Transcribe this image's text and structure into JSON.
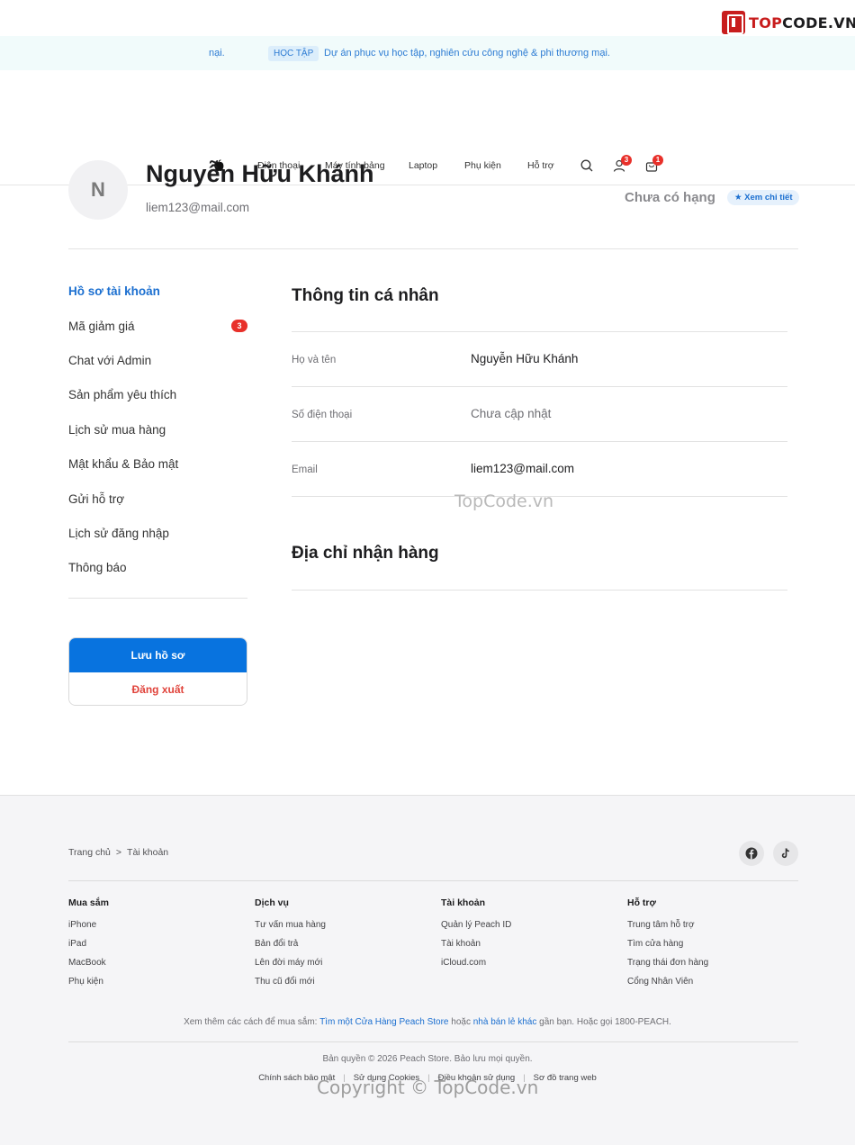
{
  "brand": {
    "logo_text_a": "TOP",
    "logo_text_b": "CODE.VN"
  },
  "announcement": {
    "left_fragment": "nại.",
    "pill": "HỌC TẬP",
    "text": "Dự án phục vụ học tập, nghiên cứu công nghệ & phi thương mại."
  },
  "nav": {
    "links": [
      "Điện thoại",
      "Máy tính bảng",
      "Laptop",
      "Phụ kiện",
      "Hỗ trợ"
    ],
    "user_badge": "3",
    "cart_badge": "1"
  },
  "profile": {
    "avatar_letter": "N",
    "name": "Nguyễn Hữu Khánh",
    "email": "liem123@mail.com",
    "rank": "Chưa có hạng",
    "rank_detail": "★ Xem chi tiết"
  },
  "sidebar": {
    "items": [
      "Hồ sơ tài khoản",
      "Mã giảm giá",
      "Chat với Admin",
      "Sản phẩm yêu thích",
      "Lịch sử mua hàng",
      "Mật khẩu & Bảo mật",
      "Gửi hỗ trợ",
      "Lịch sử đăng nhập",
      "Thông báo"
    ],
    "coupon_badge": "3",
    "save_label": "Lưu hồ sơ",
    "logout_label": "Đăng xuất"
  },
  "main": {
    "personal_title": "Thông tin cá nhân",
    "fields": [
      {
        "label": "Họ và tên",
        "value": "Nguyễn Hữu Khánh"
      },
      {
        "label": "Số điện thoại",
        "value": "Chưa cập nhật"
      },
      {
        "label": "Email",
        "value": "liem123@mail.com"
      }
    ],
    "address_title": "Địa chỉ nhận hàng"
  },
  "watermarks": {
    "middle": "TopCode.vn",
    "bottom": "Copyright © TopCode.vn"
  },
  "footer": {
    "breadcrumb": [
      "Trang chủ",
      ">",
      "Tài khoản"
    ],
    "columns": [
      {
        "title": "Mua sắm",
        "links": [
          "iPhone",
          "iPad",
          "MacBook",
          "Phụ kiện"
        ]
      },
      {
        "title": "Dịch vụ",
        "links": [
          "Tư vấn mua hàng",
          "Bản đổi trả",
          "Lên đời máy mới",
          "Thu cũ đổi mới"
        ]
      },
      {
        "title": "Tài khoản",
        "links": [
          "Quản lý Peach ID",
          "Tài khoản",
          "iCloud.com"
        ]
      },
      {
        "title": "Hỗ trợ",
        "links": [
          "Trung tâm hỗ trợ",
          "Tìm cửa hàng",
          "Trạng thái đơn hàng",
          "Cổng Nhân Viên"
        ]
      }
    ],
    "note_prefix": "Xem thêm các cách để mua sắm:",
    "note_link1": "Tìm một Cửa Hàng Peach Store",
    "note_mid": "hoặc",
    "note_link2": "nhà bán lẻ khác",
    "note_suffix": "gần bạn. Hoặc gọi 1800-PEACH.",
    "copyright": "Bản quyền © 2026 Peach Store. Bảo lưu mọi quyền.",
    "legal": [
      "Chính sách bảo mật",
      "Sử dụng Cookies",
      "Điều khoản sử dụng",
      "Sơ đồ trang web"
    ],
    "legal_sep": "|"
  }
}
